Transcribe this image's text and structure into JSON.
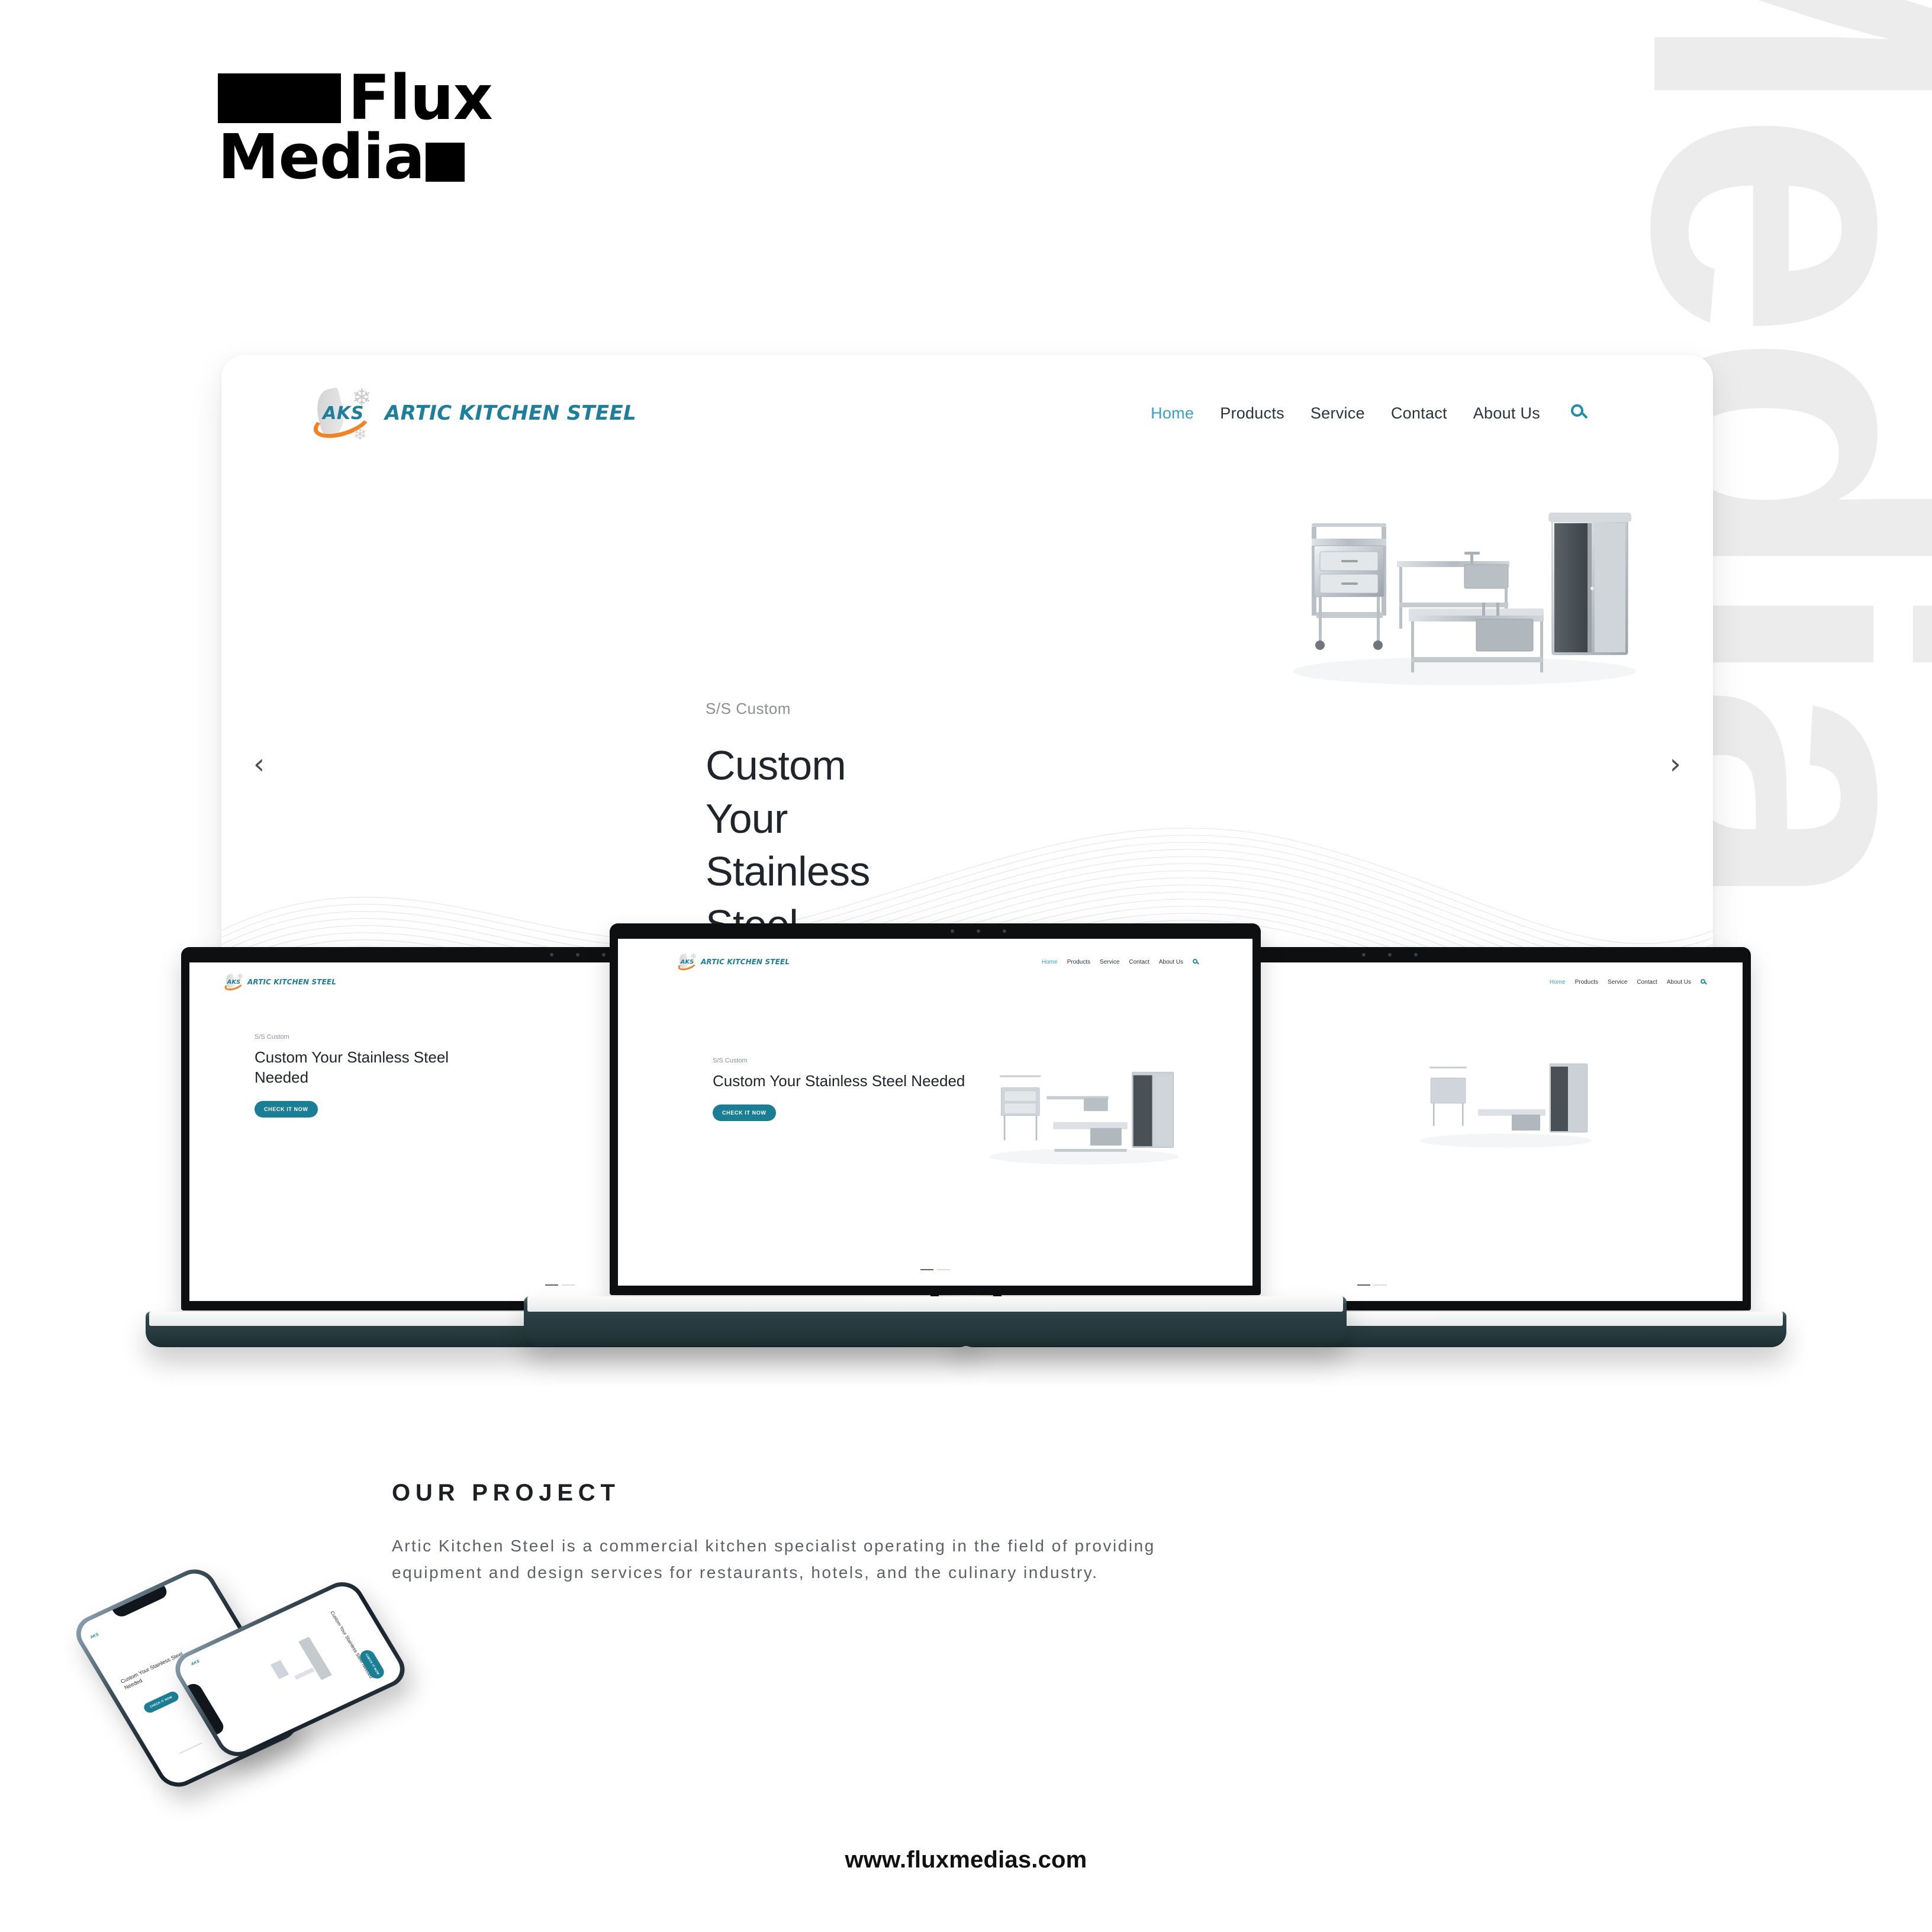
{
  "agency": {
    "logo_line1": "Flux",
    "logo_line2": "Media",
    "watermark_text": "Flux Media",
    "website": "www.fluxmedias.com"
  },
  "site": {
    "brand_abbr": "AKS",
    "brand_name": "ARTIC KITCHEN STEEL",
    "nav": [
      {
        "label": "Home",
        "active": true
      },
      {
        "label": "Products",
        "active": false
      },
      {
        "label": "Service",
        "active": false
      },
      {
        "label": "Contact",
        "active": false
      },
      {
        "label": "About Us",
        "active": false
      }
    ],
    "search_icon": "search-icon",
    "hero": {
      "eyebrow": "S/S Custom",
      "title": "Custom Your Stainless Steel Needed",
      "cta": "CHECK IT NOW",
      "prev_arrow": "‹",
      "next_arrow": "›",
      "image_alt": "stainless-steel-kitchen-equipment"
    }
  },
  "project": {
    "heading": "OUR PROJECT",
    "description": "Artic Kitchen Steel is a commercial kitchen specialist operating in the field of providing equipment and design services for restaurants, hotels, and the culinary industry."
  },
  "colors": {
    "accent_teal": "#1a7f95",
    "nav_active": "#34a4c9",
    "brand_blue": "#1b7f9e",
    "brand_orange": "#f58220",
    "laptop_base": "#2e4449",
    "watermark_gray": "#ececec"
  }
}
